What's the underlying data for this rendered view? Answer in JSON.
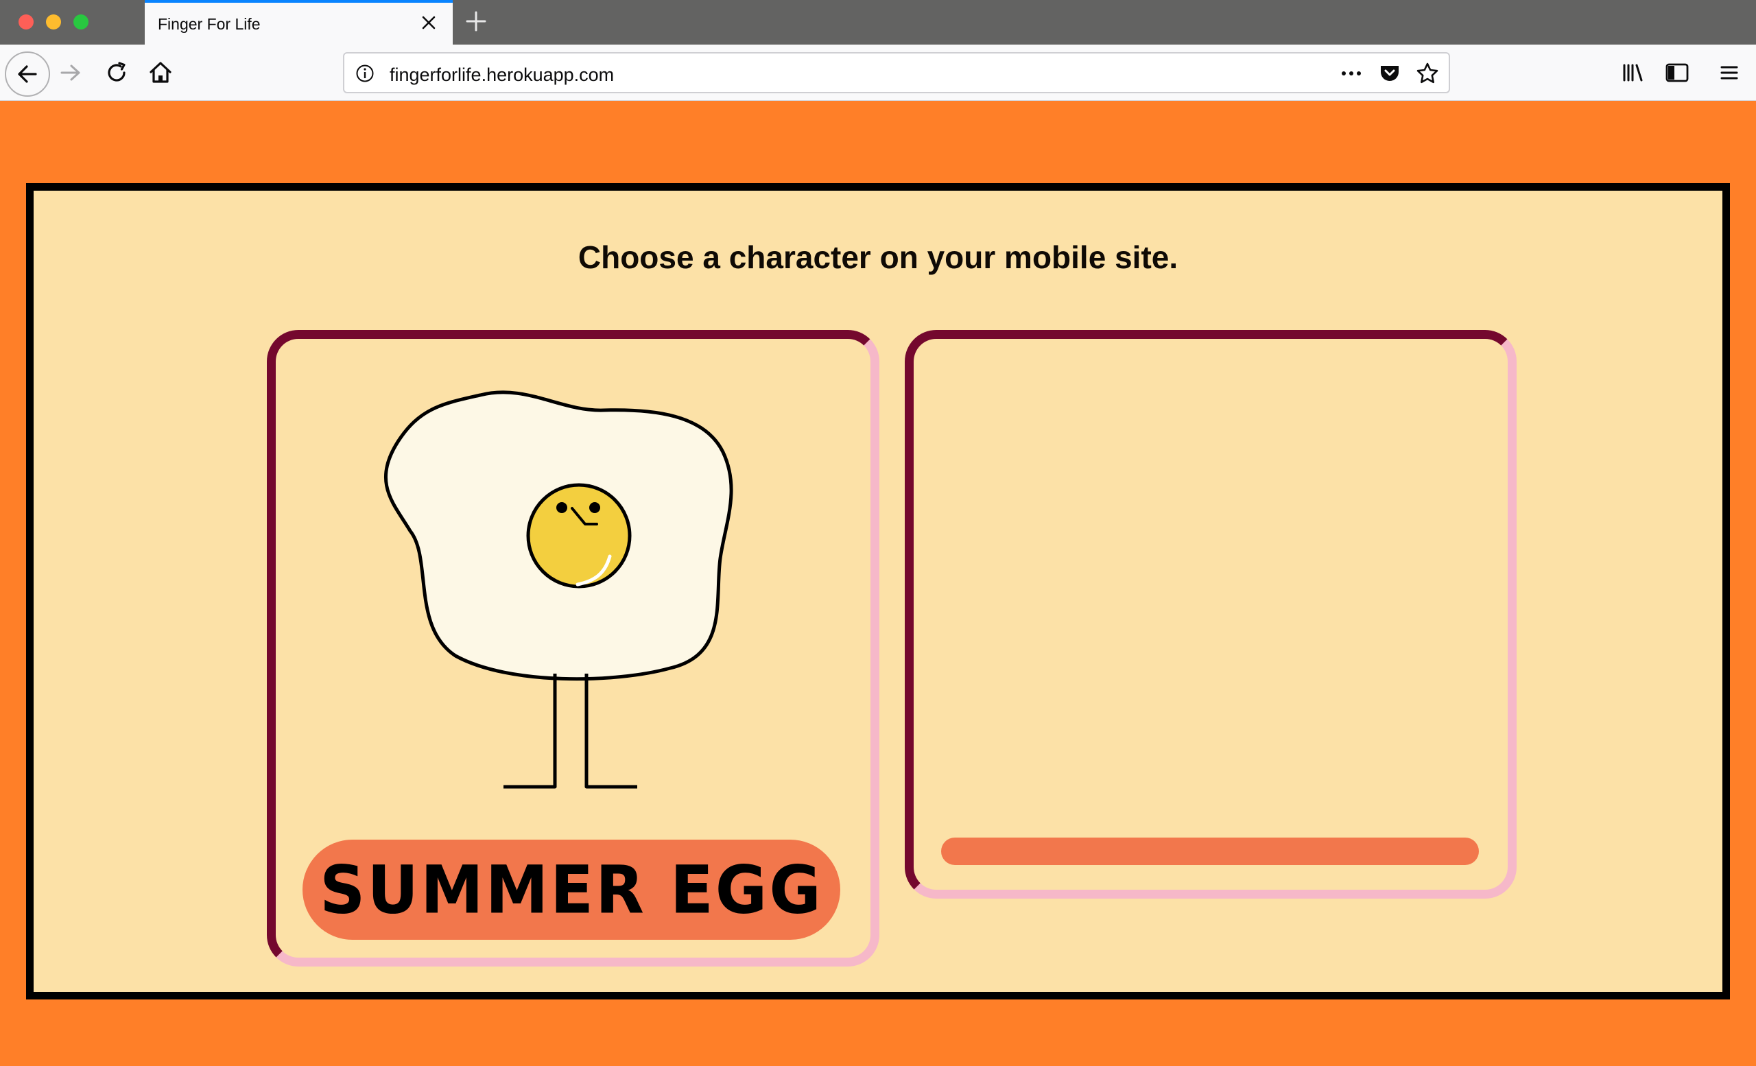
{
  "browser": {
    "tab_title": "Finger For Life",
    "url": "fingerforlife.herokuapp.com"
  },
  "icons": {
    "back": "back-arrow-icon",
    "forward": "forward-arrow-icon",
    "reload": "reload-icon",
    "home": "home-icon",
    "info": "info-icon",
    "more": "more-icon",
    "pocket": "pocket-icon",
    "bookmark": "star-icon",
    "library": "library-icon",
    "sidebar": "sidebar-icon",
    "menu": "hamburger-menu-icon",
    "close_tab": "close-icon",
    "new_tab": "plus-icon"
  },
  "page": {
    "heading": "Choose a character on your mobile site.",
    "characters": [
      {
        "name": "SUMMER EGG"
      }
    ]
  },
  "colors": {
    "page_background": "#ff7f28",
    "stage_background": "#fce1a7",
    "card_border_dark": "#74082e",
    "card_border_light": "#f6b8c9",
    "pill": "#f2774c",
    "yolk": "#f3cf3f",
    "egg_white": "#fdf8e6"
  }
}
